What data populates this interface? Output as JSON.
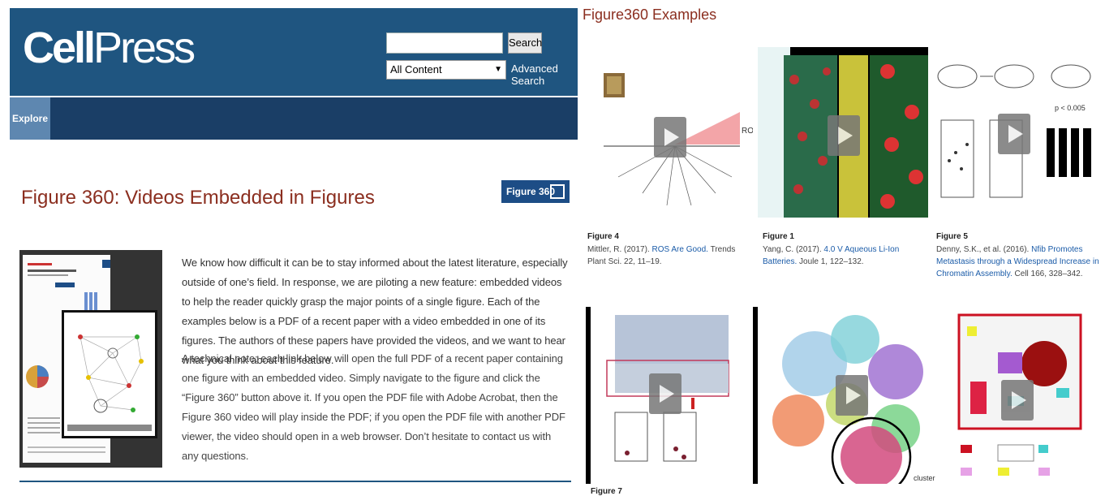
{
  "left": {
    "logo": {
      "cell": "Cell",
      "press": "Press"
    },
    "search": {
      "placeholder": "",
      "button_label": "Search",
      "scope_value": "All Content",
      "advanced_label": "Advanced Search"
    },
    "nav": {
      "explore_label": "Explore"
    },
    "page_title": "Figure 360: Videos Embedded in Figures",
    "figure360_button_label": "Figure 360",
    "paragraph1": "We know how difficult it can be to stay informed about the latest literature, especially outside of one’s field. In response, we are piloting a new feature: embedded videos to help the reader quickly grasp the major points of a single figure. Each of the examples below is a PDF of a recent paper with a video embedded in one of its figures. The authors of these papers have provided the videos, and we want to hear what you think about this feature.",
    "paragraph2": "A technical note: each link below will open the full PDF of a recent paper containing one figure with an embedded video. Simply navigate to the figure and click the “Figure 360” button above it. If you open the PDF file with Adobe Acrobat, then the Figure 360 video will play inside the PDF; if you open the PDF file with another PDF viewer, the video should open in a web browser. Don’t hesitate to contact us with any questions."
  },
  "right": {
    "title": "Figure360 Examples",
    "examples": [
      {
        "figure": "Figure 4",
        "authors": "Mittler, R. (2017).",
        "link": "ROS Are Good.",
        "rest": "Trends Plant Sci. 22, 11–19."
      },
      {
        "figure": "Figure 1",
        "authors": "Yang, C. (2017).",
        "link": "4.0 V Aqueous Li-Ion Batteries.",
        "rest": "Joule 1, 122–132."
      },
      {
        "figure": "Figure 5",
        "authors": "Denny, S.K., et al. (2016).",
        "link": "Nfib Promotes Metastasis through a Widespread Increase in Chromatin Assembly.",
        "rest": "Cell 166, 328–342."
      },
      {
        "figure": "Figure 7"
      }
    ],
    "image_labels": {
      "ros": "ROS",
      "cluster": "cluster",
      "pvalue": "p < 0.005"
    }
  },
  "colors": {
    "header": "#1f5580",
    "nav": "#1a3e66",
    "title": "#8b2e1f",
    "link": "#1a5ba8"
  }
}
